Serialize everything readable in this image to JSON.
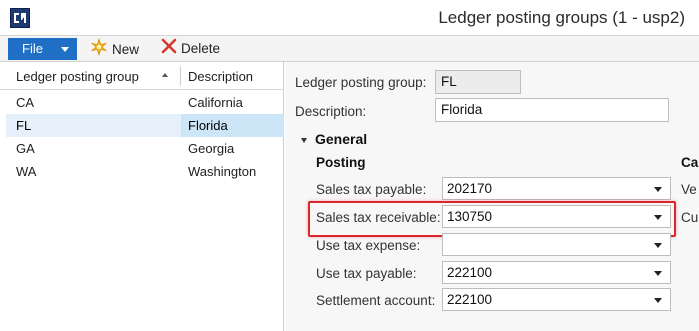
{
  "window": {
    "title": "Ledger posting groups (1 - usp2)"
  },
  "toolbar": {
    "file_label": "File",
    "new_label": "New",
    "delete_label": "Delete"
  },
  "grid": {
    "headers": [
      "Ledger posting group",
      "Description"
    ],
    "rows": [
      {
        "group": "CA",
        "description": "California"
      },
      {
        "group": "FL",
        "description": "Florida"
      },
      {
        "group": "GA",
        "description": "Georgia"
      },
      {
        "group": "WA",
        "description": "Washington"
      }
    ]
  },
  "detail": {
    "group_label": "Ledger posting group:",
    "group_value": "FL",
    "description_label": "Description:",
    "description_value": "Florida",
    "section_title": "General",
    "posting_heading": "Posting",
    "right_heading_clipped": "Ca",
    "fields": [
      {
        "label": "Sales tax payable:",
        "value": "202170"
      },
      {
        "label": "Sales tax receivable:",
        "value": "130750"
      },
      {
        "label": "Use tax expense:",
        "value": ""
      },
      {
        "label": "Use tax payable:",
        "value": "222100"
      },
      {
        "label": "Settlement account:",
        "value": "222100"
      }
    ],
    "right_labels_clipped": [
      "Ve",
      "Cu"
    ]
  },
  "colors": {
    "file_button": "#1f6fc4",
    "selection": "#cde6f7",
    "highlight_border": "#d8262b"
  }
}
